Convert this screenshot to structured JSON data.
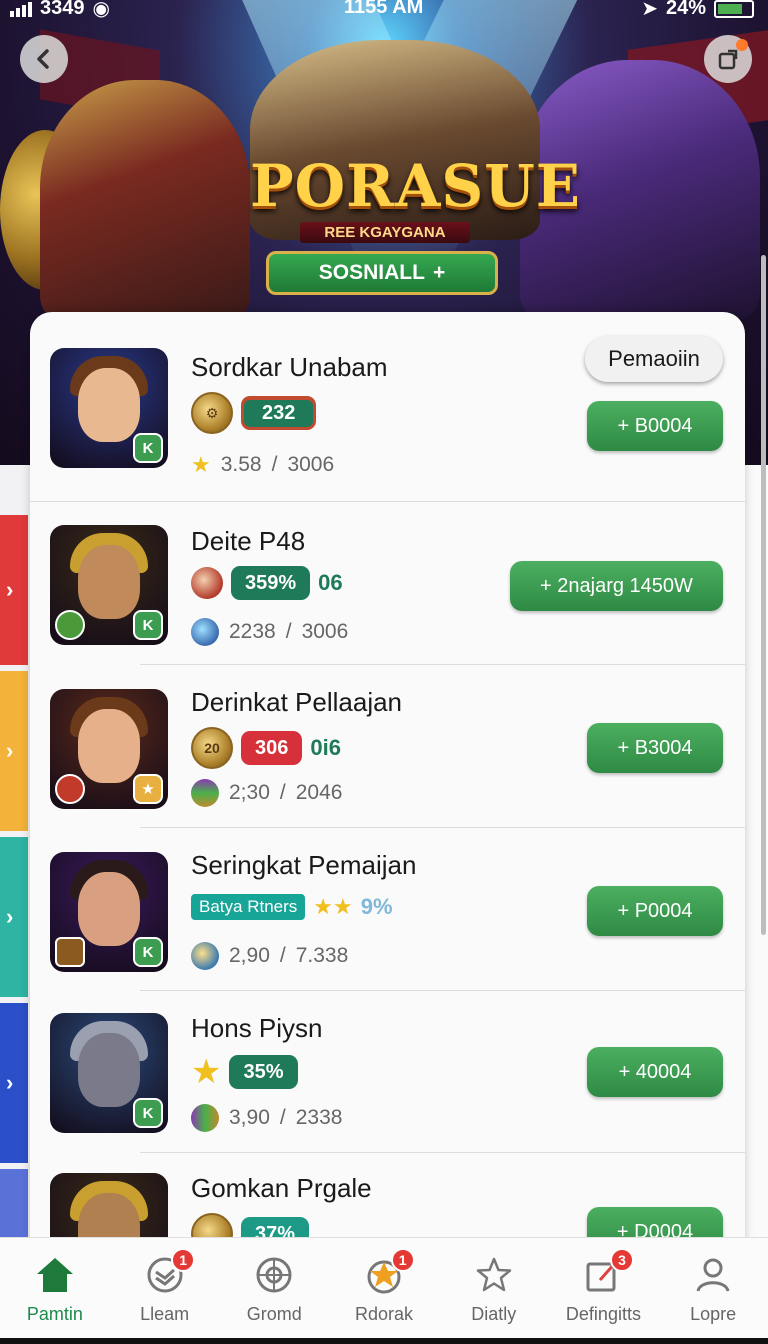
{
  "status_bar": {
    "carrier": "3349",
    "time": "1155 AM",
    "battery": "24%"
  },
  "hero": {
    "title": "PORASUE",
    "subtitle": "REE KGAYGANA",
    "button_label": "SOSNIALL",
    "button_icon": "sparkle-icon"
  },
  "rows": [
    {
      "name": "Sordkar Unabam",
      "medal_text": "",
      "pill": "232",
      "pill_style": "redbox",
      "rating": "3.58",
      "count": "3006",
      "action_label": "+ B0004",
      "thumb": {
        "bg": "#2a3a8a",
        "face": "#e8b890",
        "hair": "#6a3a1a",
        "tag": "K",
        "tag_left": ""
      },
      "pemaoin": "Pemaoiin"
    },
    {
      "name": "Deite P48",
      "pill": "359%",
      "pill_style": "green",
      "extra": "06",
      "rating": "2238",
      "count": "3006",
      "action_label": "+ 2najarg 1450W",
      "thumb": {
        "bg": "#3a2a18",
        "face": "#c08a5a",
        "hair": "#c9a030",
        "tag": "K",
        "tag_left": "#4a9a3a"
      }
    },
    {
      "name": "Derinkat Pellaajan",
      "medal_text": "20",
      "pill": "306",
      "pill_style": "red",
      "extra": "0i6",
      "rating": "2;30",
      "count": "2046",
      "action_label": "+ B3004",
      "thumb": {
        "bg": "#5a2a1a",
        "face": "#e6b08a",
        "hair": "#6a3a1a",
        "tag": "★",
        "tag_left": "#c23a2a"
      }
    },
    {
      "name": "Seringkat Pemaijan",
      "tagline": "Batya Rtners",
      "stars": "★★",
      "pct": "9%",
      "rating": "2,90",
      "count": "7.338",
      "action_label": "+ P0004",
      "thumb": {
        "bg": "#3a1a5a",
        "face": "#d8a080",
        "hair": "#2a1a1a",
        "tag": "K",
        "tag_left": "#8a5a20"
      }
    },
    {
      "name": "Hons Piysn",
      "pill": "35%",
      "pill_style": "green",
      "rating": "3,90",
      "count": "2338",
      "action_label": "+ 40004",
      "thumb": {
        "bg": "#2a4a7a",
        "face": "#7a7a8a",
        "hair": "#9aa0b0",
        "tag": "K",
        "tag_left": ""
      }
    },
    {
      "name": "Gomkan Prgale",
      "pill": "37%",
      "pill_style": "teal",
      "action_label": "+ D0004",
      "thumb": {
        "bg": "#3a2a18",
        "face": "#b08050",
        "hair": "#c9a030",
        "tag": "",
        "tag_left": ""
      }
    }
  ],
  "nav": [
    {
      "label": "Pamtin",
      "icon": "home-icon",
      "badge": ""
    },
    {
      "label": "Lleam",
      "icon": "team-icon",
      "badge": "1"
    },
    {
      "label": "Gromd",
      "icon": "globe-icon",
      "badge": ""
    },
    {
      "label": "Rdorak",
      "icon": "rank-icon",
      "badge": "1"
    },
    {
      "label": "Diatly",
      "icon": "star-icon",
      "badge": ""
    },
    {
      "label": "Defingitts",
      "icon": "edit-icon",
      "badge": "3"
    },
    {
      "label": "Lopre",
      "icon": "profile-icon",
      "badge": ""
    }
  ],
  "colors": {
    "accent_green": "#2e8a44",
    "nav_active": "#1e8a4a",
    "badge_red": "#e53935"
  }
}
